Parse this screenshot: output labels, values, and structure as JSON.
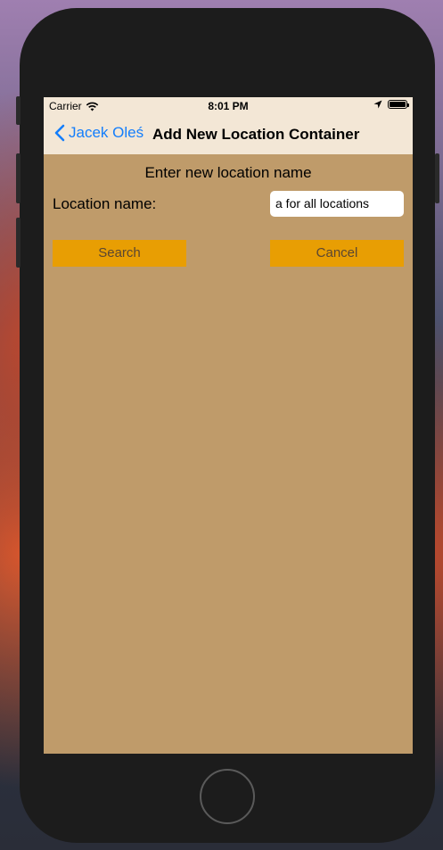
{
  "status_bar": {
    "carrier": "Carrier",
    "time": "8:01 PM"
  },
  "nav": {
    "back_label": "Jacek Oleś",
    "title": "Add New Location Container"
  },
  "form": {
    "heading": "Enter new location name",
    "location_label": "Location name:",
    "location_value": "a for all locations"
  },
  "buttons": {
    "search": "Search",
    "cancel": "Cancel"
  },
  "colors": {
    "background": "#bf9b6a",
    "bar": "#f3e7d6",
    "button": "#e89e03",
    "link": "#147efb"
  }
}
